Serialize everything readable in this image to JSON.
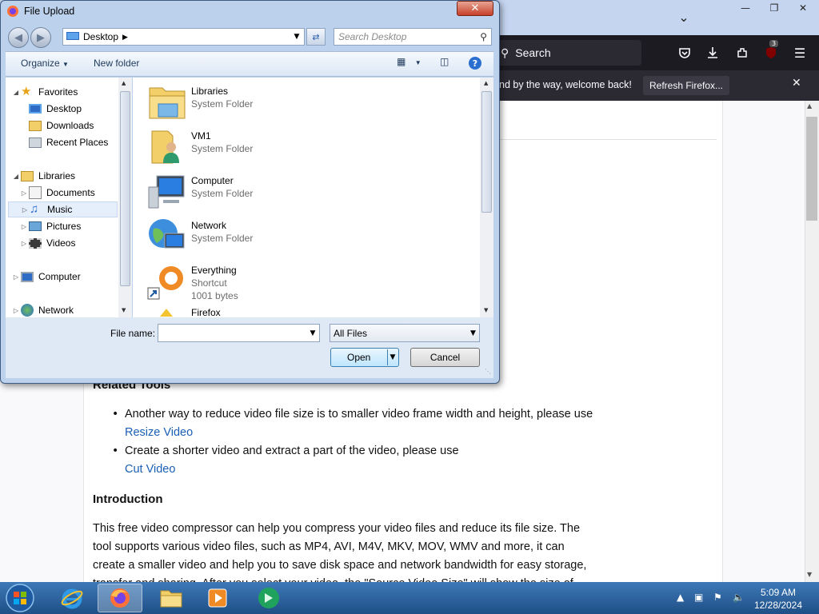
{
  "browser": {
    "search_placeholder": "Search",
    "badge_count": "3",
    "notification_text": "nd by the way, welcome back!",
    "refresh_label": "Refresh Firefox...",
    "page": {
      "section_heading": "Related Tools",
      "bullets": [
        {
          "text": "Another way to reduce video file size is to smaller video frame width and height, please use",
          "link": "Resize Video"
        },
        {
          "text": "Create a shorter video and extract a part of the video, please use",
          "link": "Cut Video"
        }
      ],
      "intro_heading": "Introduction",
      "intro_lines": [
        "This free video compressor can help you compress your video files and reduce its file size. The",
        "tool supports various video files, such as MP4, AVI, M4V, MKV, MOV, WMV and more, it can",
        "create a smaller video and help you to save disk space and network bandwidth for easy storage,",
        "transfer and sharing. After you select your video, the \"Source Video Size\" will show the size of"
      ]
    }
  },
  "dialog": {
    "title": "File Upload",
    "address": "Desktop",
    "search_placeholder": "Search Desktop",
    "commands": {
      "organize": "Organize",
      "new_folder": "New folder"
    },
    "nav": {
      "favorites": "Favorites",
      "desktop": "Desktop",
      "downloads": "Downloads",
      "recent_places": "Recent Places",
      "libraries": "Libraries",
      "documents": "Documents",
      "music": "Music",
      "pictures": "Pictures",
      "videos": "Videos",
      "computer": "Computer",
      "network": "Network"
    },
    "files": [
      {
        "name": "Libraries",
        "type": "System Folder",
        "icon": "libraries-icon"
      },
      {
        "name": "VM1",
        "type": "System Folder",
        "icon": "user-folder-icon"
      },
      {
        "name": "Computer",
        "type": "System Folder",
        "icon": "computer-icon"
      },
      {
        "name": "Network",
        "type": "System Folder",
        "icon": "network-icon"
      },
      {
        "name": "Everything",
        "type": "Shortcut",
        "size": "1001 bytes",
        "icon": "everything-icon"
      },
      {
        "name": "Firefox",
        "icon": "firefox-shortcut-icon"
      }
    ],
    "file_name_label": "File name:",
    "file_name_value": "",
    "file_type": "All Files",
    "open_label": "Open",
    "cancel_label": "Cancel"
  },
  "taskbar": {
    "time": "5:09 AM",
    "date": "12/28/2024"
  },
  "colors": {
    "dialog_frame": "#bcd2ec",
    "firefox_toolbar": "#1c1b22",
    "link": "#1a5fb4",
    "taskbar": "#2c5f99"
  }
}
